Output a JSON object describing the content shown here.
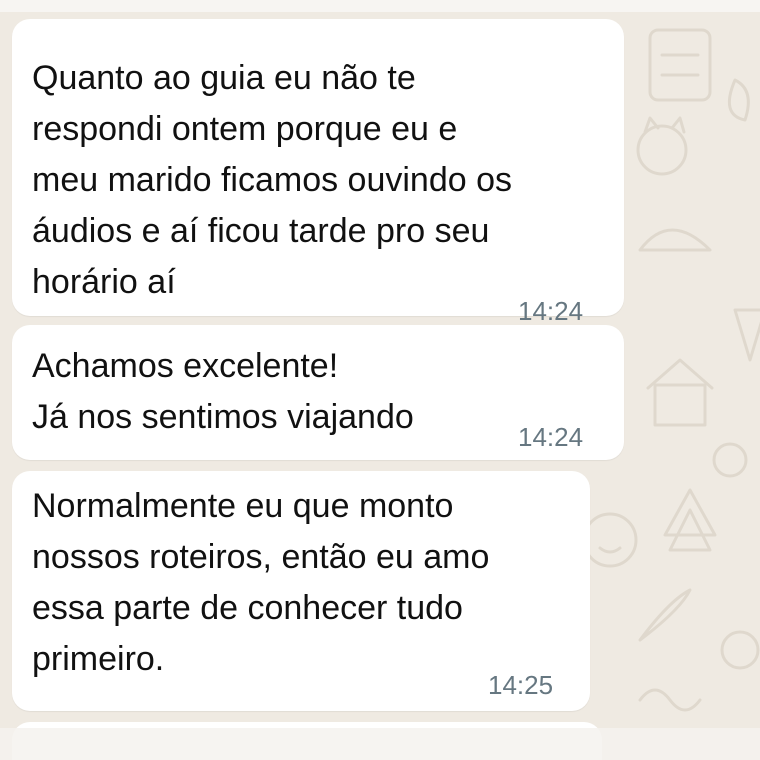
{
  "messages": [
    {
      "text": "Quanto ao guia eu não te\nrespondi ontem porque eu e\nmeu marido ficamos ouvindo os\náudios e aí ficou tarde pro seu\nhorário aí",
      "time": "14:24"
    },
    {
      "text": "Achamos excelente!\nJá nos sentimos viajando",
      "time": "14:24"
    },
    {
      "text": "Normalmente eu que monto\nnossos roteiros, então eu amo\nessa parte de conhecer tudo\nprimeiro.",
      "time": "14:25"
    }
  ],
  "colors": {
    "wallpaper": "#efeae2",
    "bubble": "#ffffff",
    "text": "#111111",
    "timestamp": "#667781",
    "doodle": "#d9d2c6"
  }
}
